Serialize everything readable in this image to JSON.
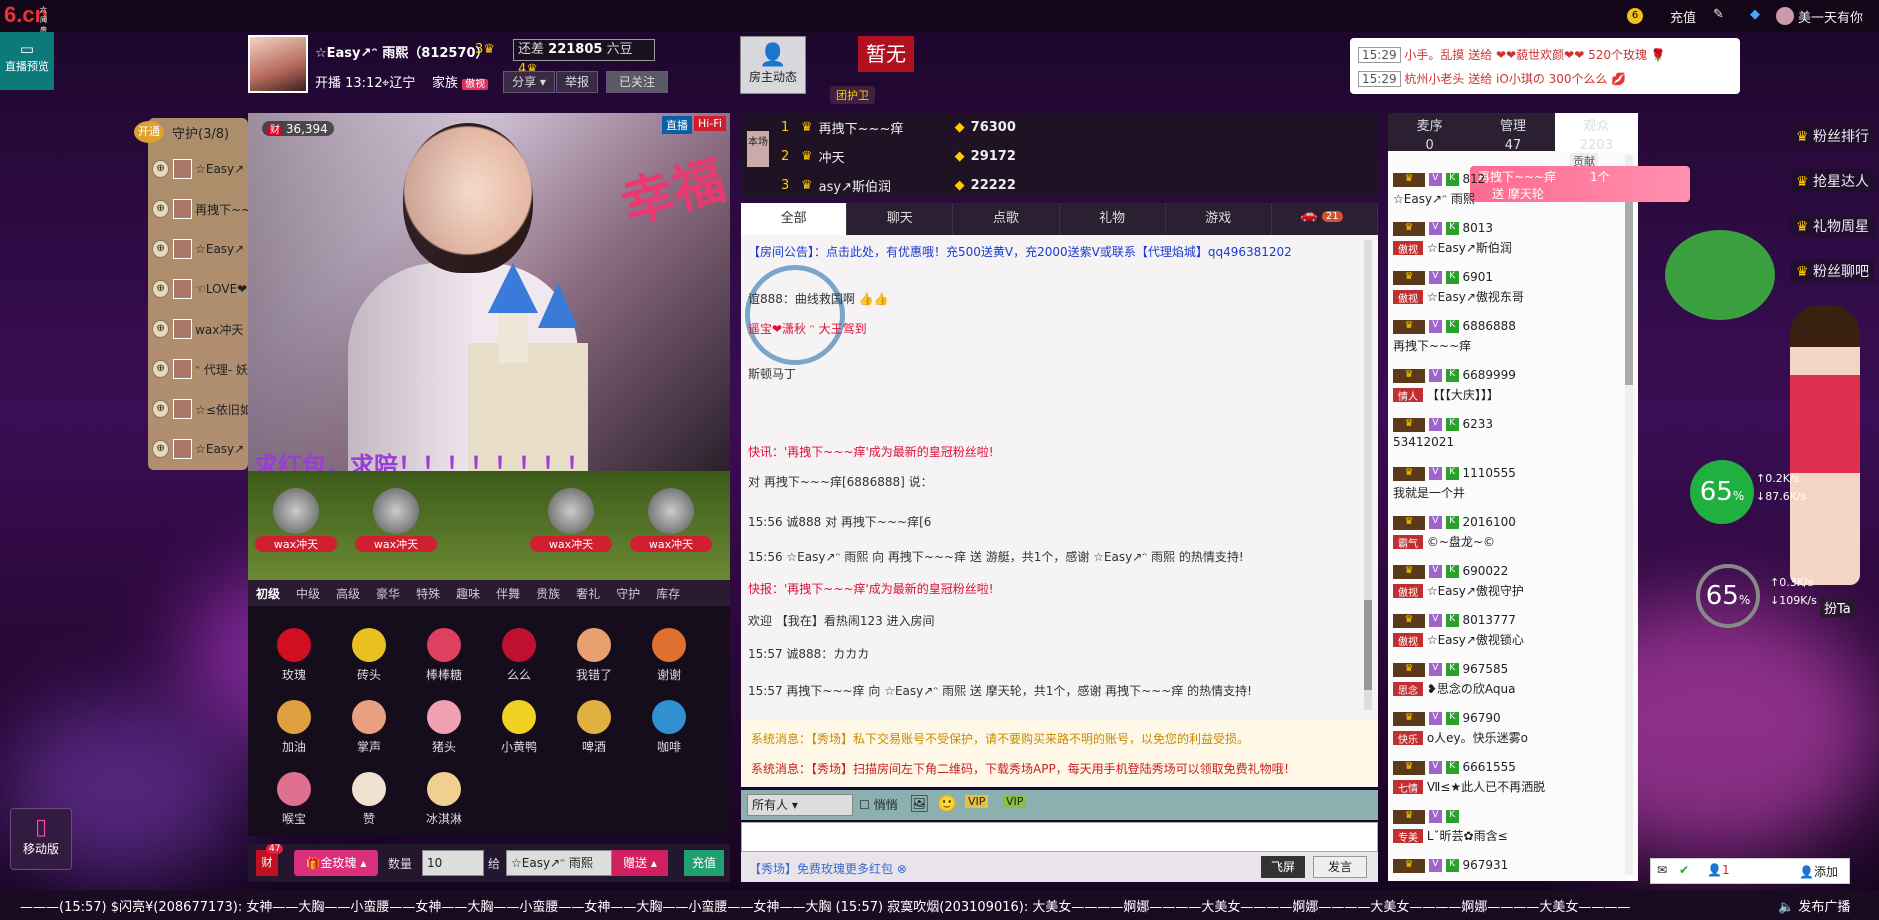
{
  "topbar": {
    "logo": "6.cn",
    "logo_sub": "六间房",
    "recharge": "充值",
    "user": "美一天有你"
  },
  "preview": {
    "label": "直播预览"
  },
  "host": {
    "name": "☆Easy↗ᵔ 雨熙（812570）",
    "badge": "3",
    "diff_label": "还差",
    "diff_value": "221805",
    "diff_unit": "六豆",
    "diff_level": "4",
    "start": "开播 13:12",
    "location": "辽宁",
    "family": "家族",
    "family_tag": "傲视",
    "share": "分享",
    "report": "举报",
    "followed": "已关注",
    "host_dynamic": "房主动态",
    "zanwu": "暂无",
    "guard_tuan": "团护卫"
  },
  "notices": [
    {
      "time": "15:29",
      "text": "小手。乱摸 送给 ❤❤藐世欢颜❤❤ 520个玫瑰"
    },
    {
      "time": "15:29",
      "text": "杭州小老头 送给 iO小琪の 300个么么"
    }
  ],
  "guard": {
    "open": "开通",
    "title": "守护(3/8)",
    "rows": [
      "☆Easy↗",
      "再拽下~~~",
      "☆Easy↗",
      "☜LOVE❤",
      "wax冲天",
      "ᵔ 代理- 妖",
      "☆≤依旧如",
      "☆Easy↗"
    ]
  },
  "video": {
    "fan_count": "36,394",
    "fan_tag": "财",
    "mode_direct": "直播",
    "mode_hifi": "Hi-Fi",
    "red_packet": "求红包，求陪！！！！！！！！"
  },
  "stage": {
    "names": [
      "wax冲天",
      "wax冲天",
      "wax冲天",
      "wax冲天"
    ]
  },
  "gift_tabs": [
    "初级",
    "中级",
    "高级",
    "豪华",
    "特殊",
    "趣味",
    "伴舞",
    "贵族",
    "奢礼",
    "守护",
    "库存"
  ],
  "gifts": [
    {
      "name": "玫瑰",
      "color": "#d01020"
    },
    {
      "name": "砖头",
      "color": "#e8c020"
    },
    {
      "name": "棒棒糖",
      "color": "#e04060"
    },
    {
      "name": "么么",
      "color": "#c01030"
    },
    {
      "name": "我错了",
      "color": "#e8a070"
    },
    {
      "name": "谢谢",
      "color": "#e07030"
    },
    {
      "name": "加油",
      "color": "#e0a040"
    },
    {
      "name": "掌声",
      "color": "#e8a080"
    },
    {
      "name": "猪头",
      "color": "#f0a0b0"
    },
    {
      "name": "小黄鸭",
      "color": "#f0d020"
    },
    {
      "name": "啤酒",
      "color": "#e0b040"
    },
    {
      "name": "咖啡",
      "color": "#3090d0"
    },
    {
      "name": "喉宝",
      "color": "#e07090"
    },
    {
      "name": "赞",
      "color": "#f0e0d0"
    },
    {
      "name": "冰淇淋",
      "color": "#f0d090"
    }
  ],
  "send": {
    "count_label": "47",
    "wallet_tag": "财",
    "selected_gift": "金玫瑰",
    "qty_label": "数量",
    "qty_value": "10",
    "to_label": "给",
    "to_user": "☆Easy↗ᵔ 雨熙",
    "give": "赠送",
    "recharge": "充值"
  },
  "rank": [
    {
      "rank": "1",
      "name": "再拽下~~~痒",
      "value": "76300"
    },
    {
      "rank": "2",
      "name": "冲天",
      "value": "29172"
    },
    {
      "rank": "3",
      "name": "asy↗斯伯润",
      "value": "22222"
    }
  ],
  "rank_tag": "本场",
  "chat_tabs": [
    "全部",
    "聊天",
    "点歌",
    "礼物",
    "游戏"
  ],
  "chat_car_count": "21",
  "chat": [
    {
      "text": "【房间公告】：点击此处，有优惠哦！充500送黄V，充2000送紫V或联系【代理焰城】qq496381202",
      "cls": "blue"
    },
    {
      "text": "谊888：曲线救国啊 👍👍",
      "cls": ""
    },
    {
      "text": "遥宝❤潇秋 ᵔ 大王驾到",
      "cls": "red"
    },
    {
      "text": "斯顿马丁",
      "cls": ""
    },
    {
      "text": "快讯：'再拽下~~~痒'成为最新的皇冠粉丝啦!",
      "cls": "red"
    },
    {
      "text": "对 再拽下~~~痒[6886888] 说：",
      "cls": ""
    },
    {
      "text": "15:56  诚888 对 再拽下~~~痒[6",
      "cls": ""
    },
    {
      "text": "15:56  ☆Easy↗ᵔ 雨熙 向 再拽下~~~痒 送 游艇，共1个，感谢 ☆Easy↗ᵔ 雨熙 的热情支持!",
      "cls": ""
    },
    {
      "text": "快报：'再拽下~~~痒'成为最新的皇冠粉丝啦!",
      "cls": "red"
    },
    {
      "text": "欢迎 【我在】看热闹123 进入房间",
      "cls": ""
    },
    {
      "text": "15:57  诚888：カカカ",
      "cls": ""
    },
    {
      "text": "15:57  再拽下~~~痒 向 ☆Easy↗ᵔ 雨熙 送 摩天轮，共1个，感谢 再拽下~~~痒 的热情支持!",
      "cls": ""
    }
  ],
  "system": [
    "系统消息：【秀场】私下交易账号不受保护，请不要购买来路不明的账号，以免您的利益受损。",
    "系统消息：【秀场】扫描房间左下角二维码，下载秀场APP，每天用手机登陆秀场可以领取免费礼物哦！"
  ],
  "chat_input": {
    "target": "所有人",
    "whisper": "悄悄",
    "tip": "【秀场】免费玫瑰更多红包",
    "fly": "飞屏",
    "send": "发言"
  },
  "aud_tabs": [
    {
      "label": "麦序",
      "count": "0"
    },
    {
      "label": "管理",
      "count": "47"
    },
    {
      "label": "观众",
      "count": "2203"
    }
  ],
  "aud_contrib": "贡献",
  "audience": [
    {
      "id": "812",
      "name": "☆Easy↗ᵔ 雨熙",
      "tag": ""
    },
    {
      "id": "8013",
      "name": "☆Easy↗斯伯润",
      "tag": "傲视"
    },
    {
      "id": "6901",
      "name": "☆Easy↗傲视东哥",
      "tag": "傲视"
    },
    {
      "id": "6886888",
      "name": "再拽下~~~痒",
      "tag": ""
    },
    {
      "id": "6689999",
      "name": "【【【大庆】】】",
      "tag": "情人"
    },
    {
      "id": "6233",
      "name": "53412021",
      "tag": ""
    },
    {
      "id": "1110555",
      "name": "我就是一个井",
      "tag": ""
    },
    {
      "id": "2016100",
      "name": "©~盘龙~©",
      "tag": "霸气"
    },
    {
      "id": "690022",
      "name": "☆Easy↗傲视守护",
      "tag": "傲视"
    },
    {
      "id": "8013777",
      "name": "☆Easy↗傲视锁心",
      "tag": "傲视"
    },
    {
      "id": "967585",
      "name": "❥思念の欣Aqua",
      "tag": "思念"
    },
    {
      "id": "96790",
      "name": "o人ey。快乐迷雾o",
      "tag": "快乐"
    },
    {
      "id": "6661555",
      "name": "Ⅶ≤★此人已不再洒脱",
      "tag": "七情"
    },
    {
      "id": "",
      "name": "Lˇ昕芸✿雨含≤",
      "tag": "专美"
    },
    {
      "id": "967931",
      "name": "",
      "tag": ""
    }
  ],
  "gift_banner": {
    "user": "再拽下~~~痒",
    "count": "1个",
    "gift": "送 摩天轮"
  },
  "fans": [
    "粉丝排行",
    "抢星达人",
    "礼物周星",
    "粉丝聊吧"
  ],
  "speed": [
    {
      "pct": "65",
      "up": "0.2K/s",
      "down": "87.6K/s"
    },
    {
      "pct": "65",
      "up": "0.3K/s",
      "down": "109K/s"
    }
  ],
  "dressup": "扮Ta",
  "mobile": "移动版",
  "bottom": {
    "text": "———(15:57)    $闪亮¥(208677173): 女神——大胸——小蛮腰——女神——大胸——小蛮腰——女神——大胸——小蛮腰——女神——大胸    (15:57)    寂寞吹烟(203109016): 大美女————婀娜————大美女————婀娜————大美女————婀娜————大美女————",
    "broadcast": "发布广播",
    "online": "1",
    "add": "添加"
  }
}
